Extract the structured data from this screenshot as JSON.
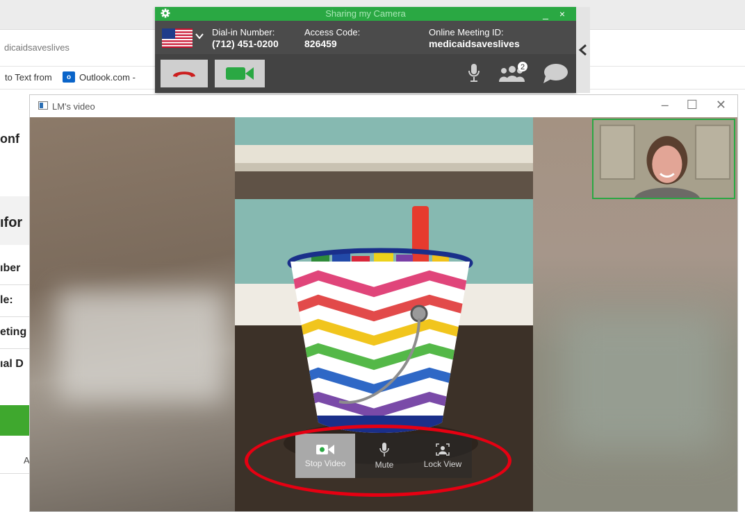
{
  "browser": {
    "address_fragment": "dicaidsaveslives",
    "bookmark_1": "to Text from",
    "bookmark_2": "Outlook.com -",
    "outlook_icon_letter": "o"
  },
  "background_page": {
    "frag_conf": "onf",
    "frag_info": "ıfor",
    "frag_number": "ıber",
    "frag_code": "le:",
    "frag_meeting": "eting",
    "frag_dial": "ıal D",
    "frag_bottom": "Ar"
  },
  "meeting_bar": {
    "title": "Sharing my Camera",
    "title_controls": "_ ×",
    "dial_in_label": "Dial-in Number:",
    "dial_in_value": "(712) 451-0200",
    "access_code_label": "Access Code:",
    "access_code_value": "826459",
    "meeting_id_label": "Online Meeting ID:",
    "meeting_id_value": "medicaidsaveslives",
    "participant_count": "2",
    "colors": {
      "title_bg": "#2aa843",
      "bar_bg": "#3d3d3d",
      "hangup_red": "#cc1f1f"
    }
  },
  "video_window": {
    "title": "LM's video",
    "controls": {
      "stop_video": "Stop Video",
      "mute": "Mute",
      "lock_view": "Lock View"
    },
    "highlight_color": "#e60012"
  }
}
